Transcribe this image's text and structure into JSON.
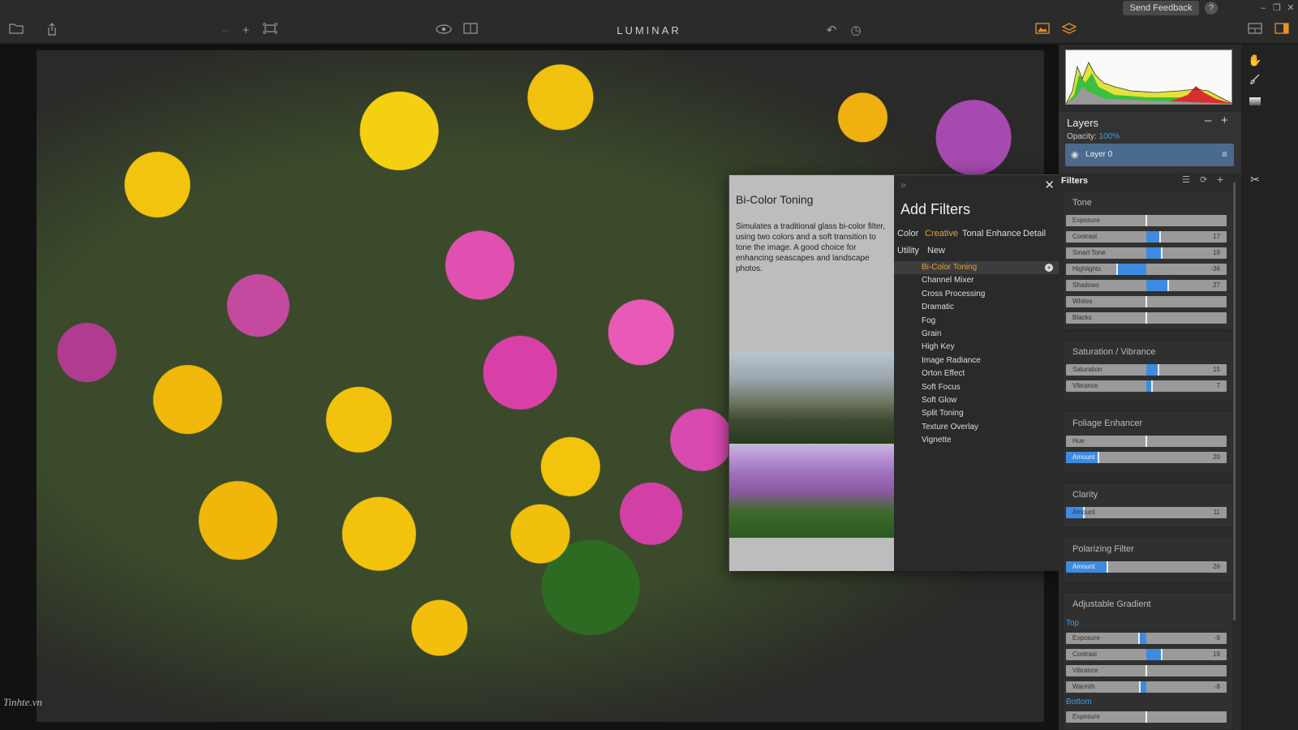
{
  "titlebar": {
    "feedback_label": "Send Feedback",
    "help_label": "?",
    "minimize": "–",
    "restore": "❐",
    "close": "✕"
  },
  "toolbar": {
    "app_title": "LUMINAR",
    "icons": {
      "open": "folder-icon",
      "export": "share-icon",
      "zoom_out": "minus-icon",
      "zoom_in": "plus-icon",
      "fit": "fit-screen-icon",
      "preview": "eye-icon",
      "compare": "compare-icon",
      "undo": "undo-icon",
      "history": "history-icon",
      "presets": "image-icon",
      "layers": "layers-icon",
      "layout": "layout-icon",
      "panel": "panel-icon"
    }
  },
  "watermark": "Tinhte.vn",
  "popup": {
    "collapse": "»",
    "close": "✕",
    "title": "Add Filters",
    "description_title": "Bi-Color Toning",
    "description_text": "Simulates a traditional glass bi-color filter, using two colors and a soft transition to tone the image. A good choice for enhancing seascapes and landscape photos.",
    "categories": [
      "Color",
      "Creative",
      "Tonal Enhance",
      "Detail",
      "Utility",
      "New"
    ],
    "active_category": "Creative",
    "filters": [
      "Bi-Color Toning",
      "Channel Mixer",
      "Cross Processing",
      "Dramatic",
      "Fog",
      "Grain",
      "High Key",
      "Image Radiance",
      "Orton Effect",
      "Soft Focus",
      "Soft Glow",
      "Split Toning",
      "Texture Overlay",
      "Vignette"
    ],
    "selected_filter": "Bi-Color Toning",
    "add_symbol": "+"
  },
  "layers": {
    "title": "Layers",
    "minus": "–",
    "plus": "+",
    "opacity_label": "Opacity:",
    "opacity_value": "100%",
    "layer_name": "Layer 0",
    "eye": "◉",
    "settings": "≡"
  },
  "filters_panel": {
    "title": "Filters",
    "tone": {
      "title": "Tone",
      "sliders": [
        {
          "label": "Exposure",
          "value": "",
          "level": 0.5
        },
        {
          "label": "Contrast",
          "value": "17",
          "level": 0.585
        },
        {
          "label": "Smart Tone",
          "value": "19",
          "level": 0.595
        },
        {
          "label": "Highlights",
          "value": "-36",
          "level": 0.32
        },
        {
          "label": "Shadows",
          "value": "27",
          "level": 0.635
        },
        {
          "label": "Whites",
          "value": "",
          "level": 0.5
        },
        {
          "label": "Blacks",
          "value": "",
          "level": 0.5
        }
      ]
    },
    "saturation": {
      "title": "Saturation / Vibrance",
      "sliders": [
        {
          "label": "Saturation",
          "value": "15",
          "level": 0.575
        },
        {
          "label": "Vibrance",
          "value": "7",
          "level": 0.535
        }
      ]
    },
    "foliage": {
      "title": "Foliage Enhancer",
      "sliders": [
        {
          "label": "Hue",
          "value": "",
          "level": 0.5
        },
        {
          "label": "Amount",
          "value": "20",
          "level": 0.2
        }
      ]
    },
    "clarity": {
      "title": "Clarity",
      "sliders": [
        {
          "label": "Amount",
          "value": "11",
          "level": 0.11
        }
      ]
    },
    "polarizing": {
      "title": "Polarizing Filter",
      "sliders": [
        {
          "label": "Amount",
          "value": "26",
          "level": 0.26
        }
      ]
    },
    "gradient": {
      "title": "Adjustable Gradient",
      "top_label": "Top",
      "bottom_label": "Bottom",
      "sliders": [
        {
          "label": "Exposure",
          "value": "-9",
          "level": 0.455
        },
        {
          "label": "Contrast",
          "value": "19",
          "level": 0.595
        },
        {
          "label": "Vibrance",
          "value": "",
          "level": 0.5
        },
        {
          "label": "Warmth",
          "value": "-8",
          "level": 0.46
        }
      ],
      "bottom_slider": {
        "label": "Exposure",
        "value": "",
        "level": 0.5
      }
    }
  },
  "tools": {
    "hand": "hand-icon",
    "brush": "brush-icon",
    "gradient": "gradient-icon",
    "transform": "crop-icon"
  },
  "colors": {
    "accent": "#3d8be0",
    "highlight": "#e8a13a",
    "panel": "#2b2b2b"
  }
}
